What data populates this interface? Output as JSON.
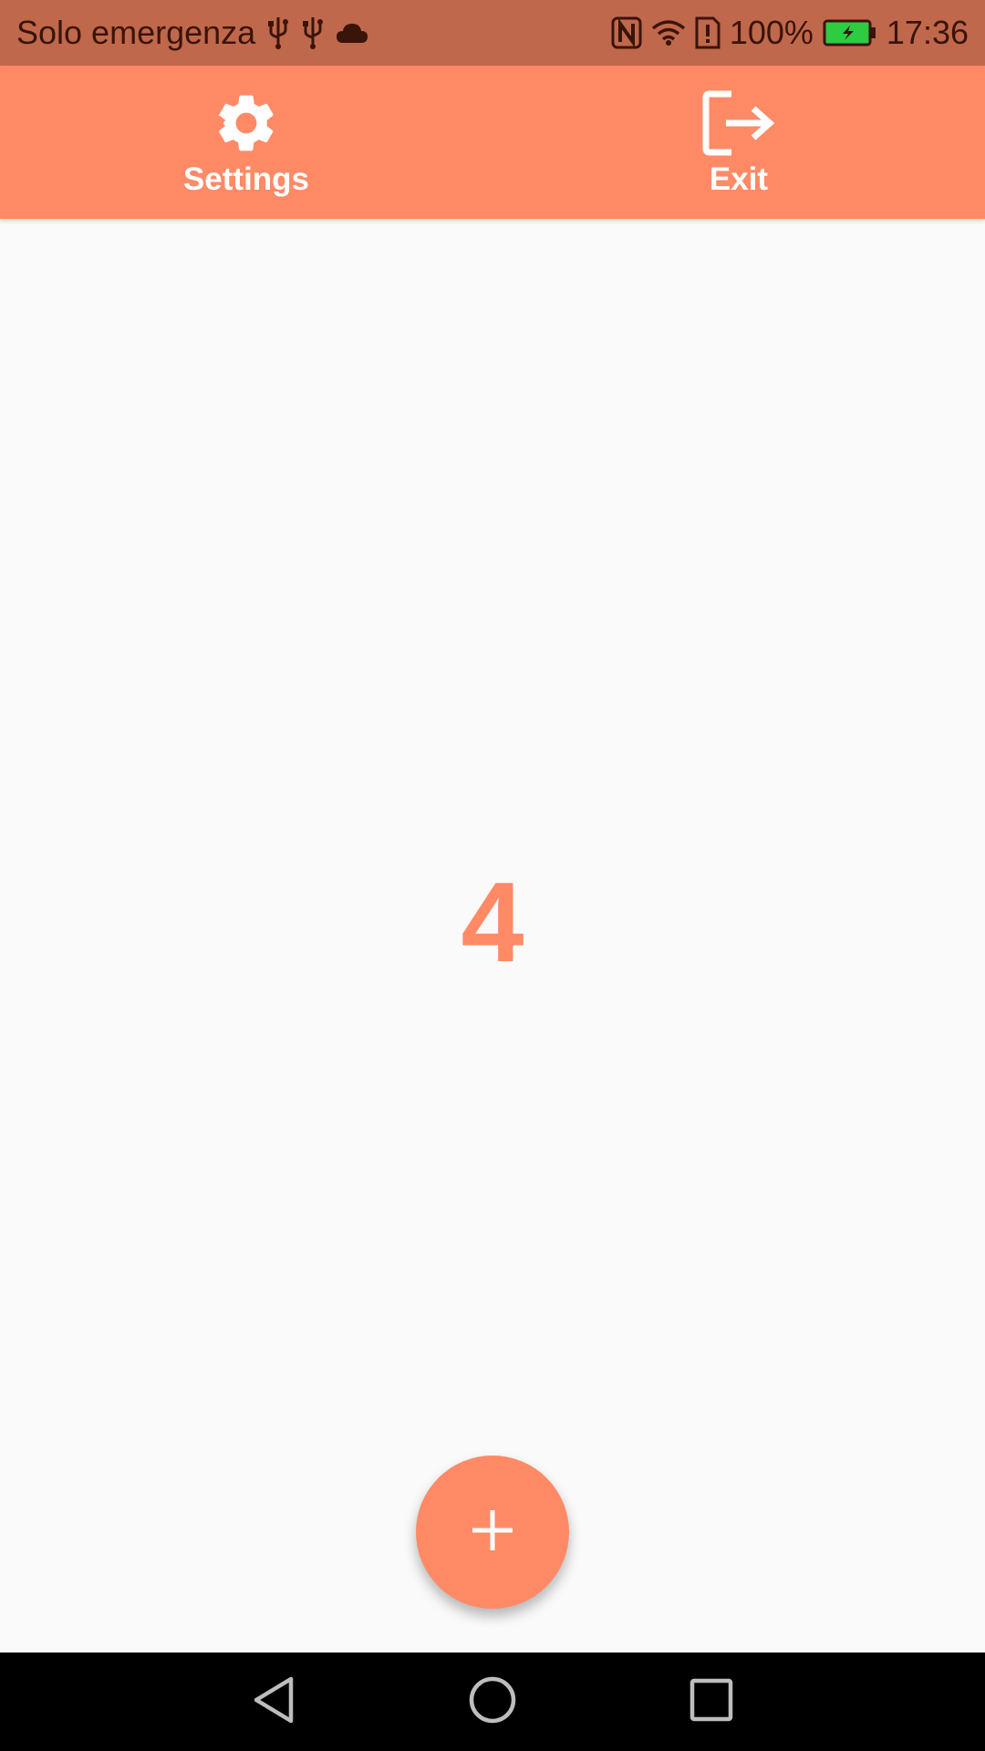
{
  "status_bar": {
    "carrier_text": "Solo emergenza",
    "battery_percent": "100%",
    "time": "17:36",
    "icons": [
      "usb-icon",
      "usb-icon",
      "cloud-icon",
      "nfc-icon",
      "wifi-icon",
      "sim-alert-icon",
      "battery-charging-icon"
    ]
  },
  "toolbar": {
    "settings_label": "Settings",
    "exit_label": "Exit"
  },
  "main": {
    "counter_value": "4"
  },
  "fab": {
    "icon": "plus-icon"
  },
  "nav_bar": {
    "buttons": [
      "back-icon",
      "home-icon",
      "recents-icon"
    ]
  },
  "colors": {
    "accent": "#ff8a65",
    "status_bar": "#c0684b",
    "background": "#fafafa"
  }
}
